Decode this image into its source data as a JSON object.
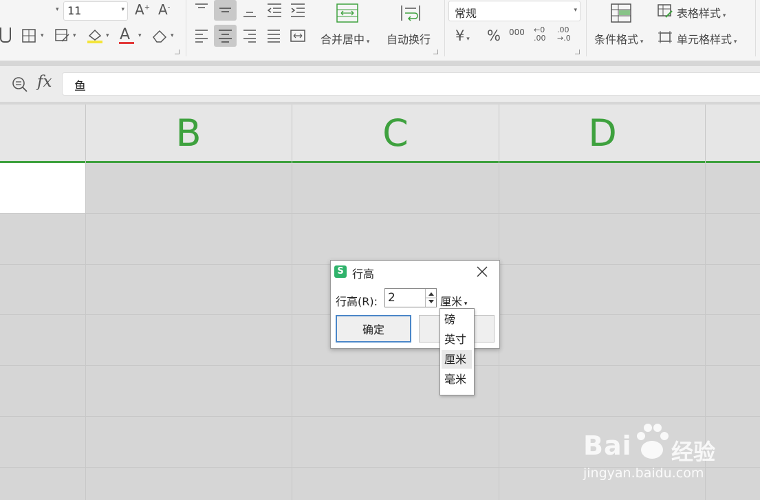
{
  "ribbon": {
    "font_size_value": "11",
    "merge_center_label": "合并居中",
    "wrap_text_label": "自动换行",
    "number_format_value": "常规",
    "currency_symbol": "¥",
    "percent_symbol": "%",
    "thousands_label": "000",
    "inc_decimal_top": "←0",
    "inc_decimal_bottom": ".00",
    "dec_decimal_top": ".00",
    "dec_decimal_bottom": "→.0",
    "conditional_format_label": "条件格式",
    "table_style_label": "表格样式",
    "cell_style_label": "单元格样式"
  },
  "formula_bar": {
    "fx_label": "fx",
    "cell_content": "鱼"
  },
  "columns": [
    "B",
    "C",
    "D"
  ],
  "dialog": {
    "title": "行高",
    "app_badge": "S",
    "row_height_label": "行高(R):",
    "row_height_value": "2",
    "unit_selected": "厘米",
    "ok_label": "确定",
    "unit_options": [
      "磅",
      "英寸",
      "厘米",
      "毫米"
    ],
    "selected_option": "厘米"
  },
  "watermark": {
    "brand_text": "Bai",
    "brand_text2": "经验",
    "url": "jingyan.baidu.com"
  },
  "colors": {
    "accent_green": "#3ea13e",
    "underline_red": "#e23a3a",
    "highlight_yellow": "#f4e53a"
  }
}
